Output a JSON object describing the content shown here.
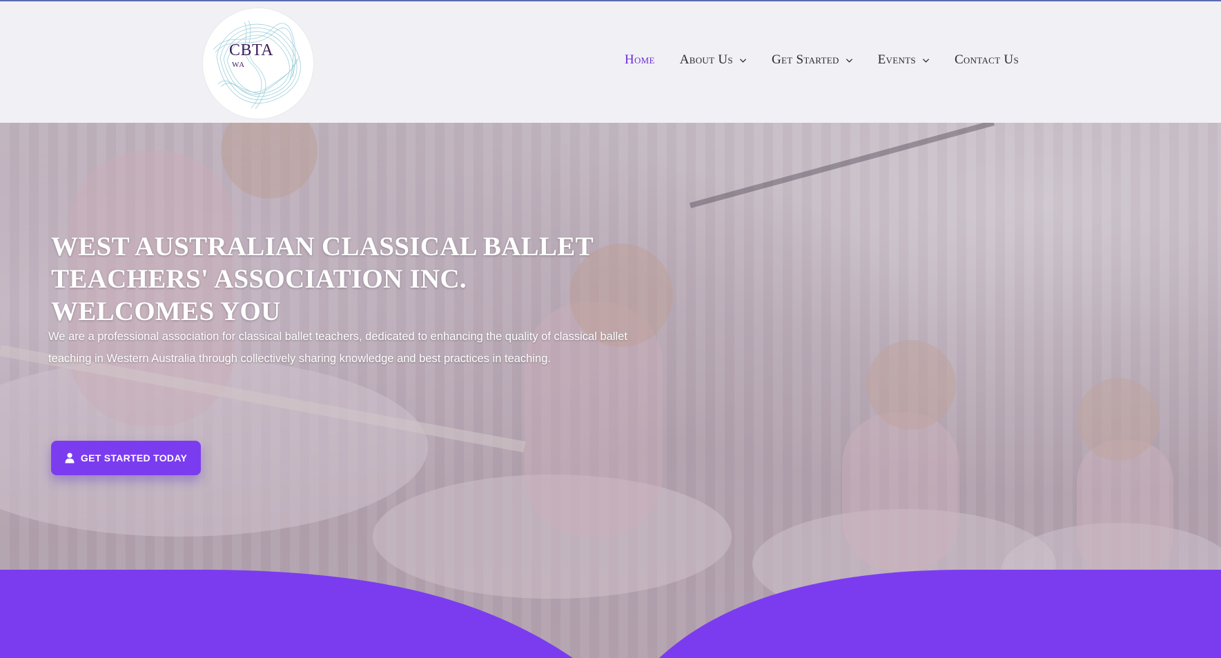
{
  "logo": {
    "title": "CBTA",
    "subtitle": "WA"
  },
  "nav": {
    "items": [
      {
        "label": "Home",
        "has_dropdown": false,
        "active": true
      },
      {
        "label": "About Us",
        "has_dropdown": true,
        "active": false
      },
      {
        "label": "Get Started",
        "has_dropdown": true,
        "active": false
      },
      {
        "label": "Events",
        "has_dropdown": true,
        "active": false
      },
      {
        "label": "Contact Us",
        "has_dropdown": false,
        "active": false
      }
    ]
  },
  "hero": {
    "title": "WEST AUSTRALIAN CLASSICAL BALLET TEACHERS' ASSOCIATION INC. WELCOMES YOU",
    "description": "We are a professional association for classical ballet teachers, dedicated to enhancing the quality of classical ballet teaching in Western Australia through collectively sharing knowledge and best practices in teaching.",
    "cta_label": "GET STARTED TODAY",
    "cta_icon": "user-icon"
  },
  "colors": {
    "accent": "#7b3cf0",
    "nav_active": "#6c2dd6",
    "header_bg": "#f1f0f5",
    "wave": "#7b3cf0"
  }
}
